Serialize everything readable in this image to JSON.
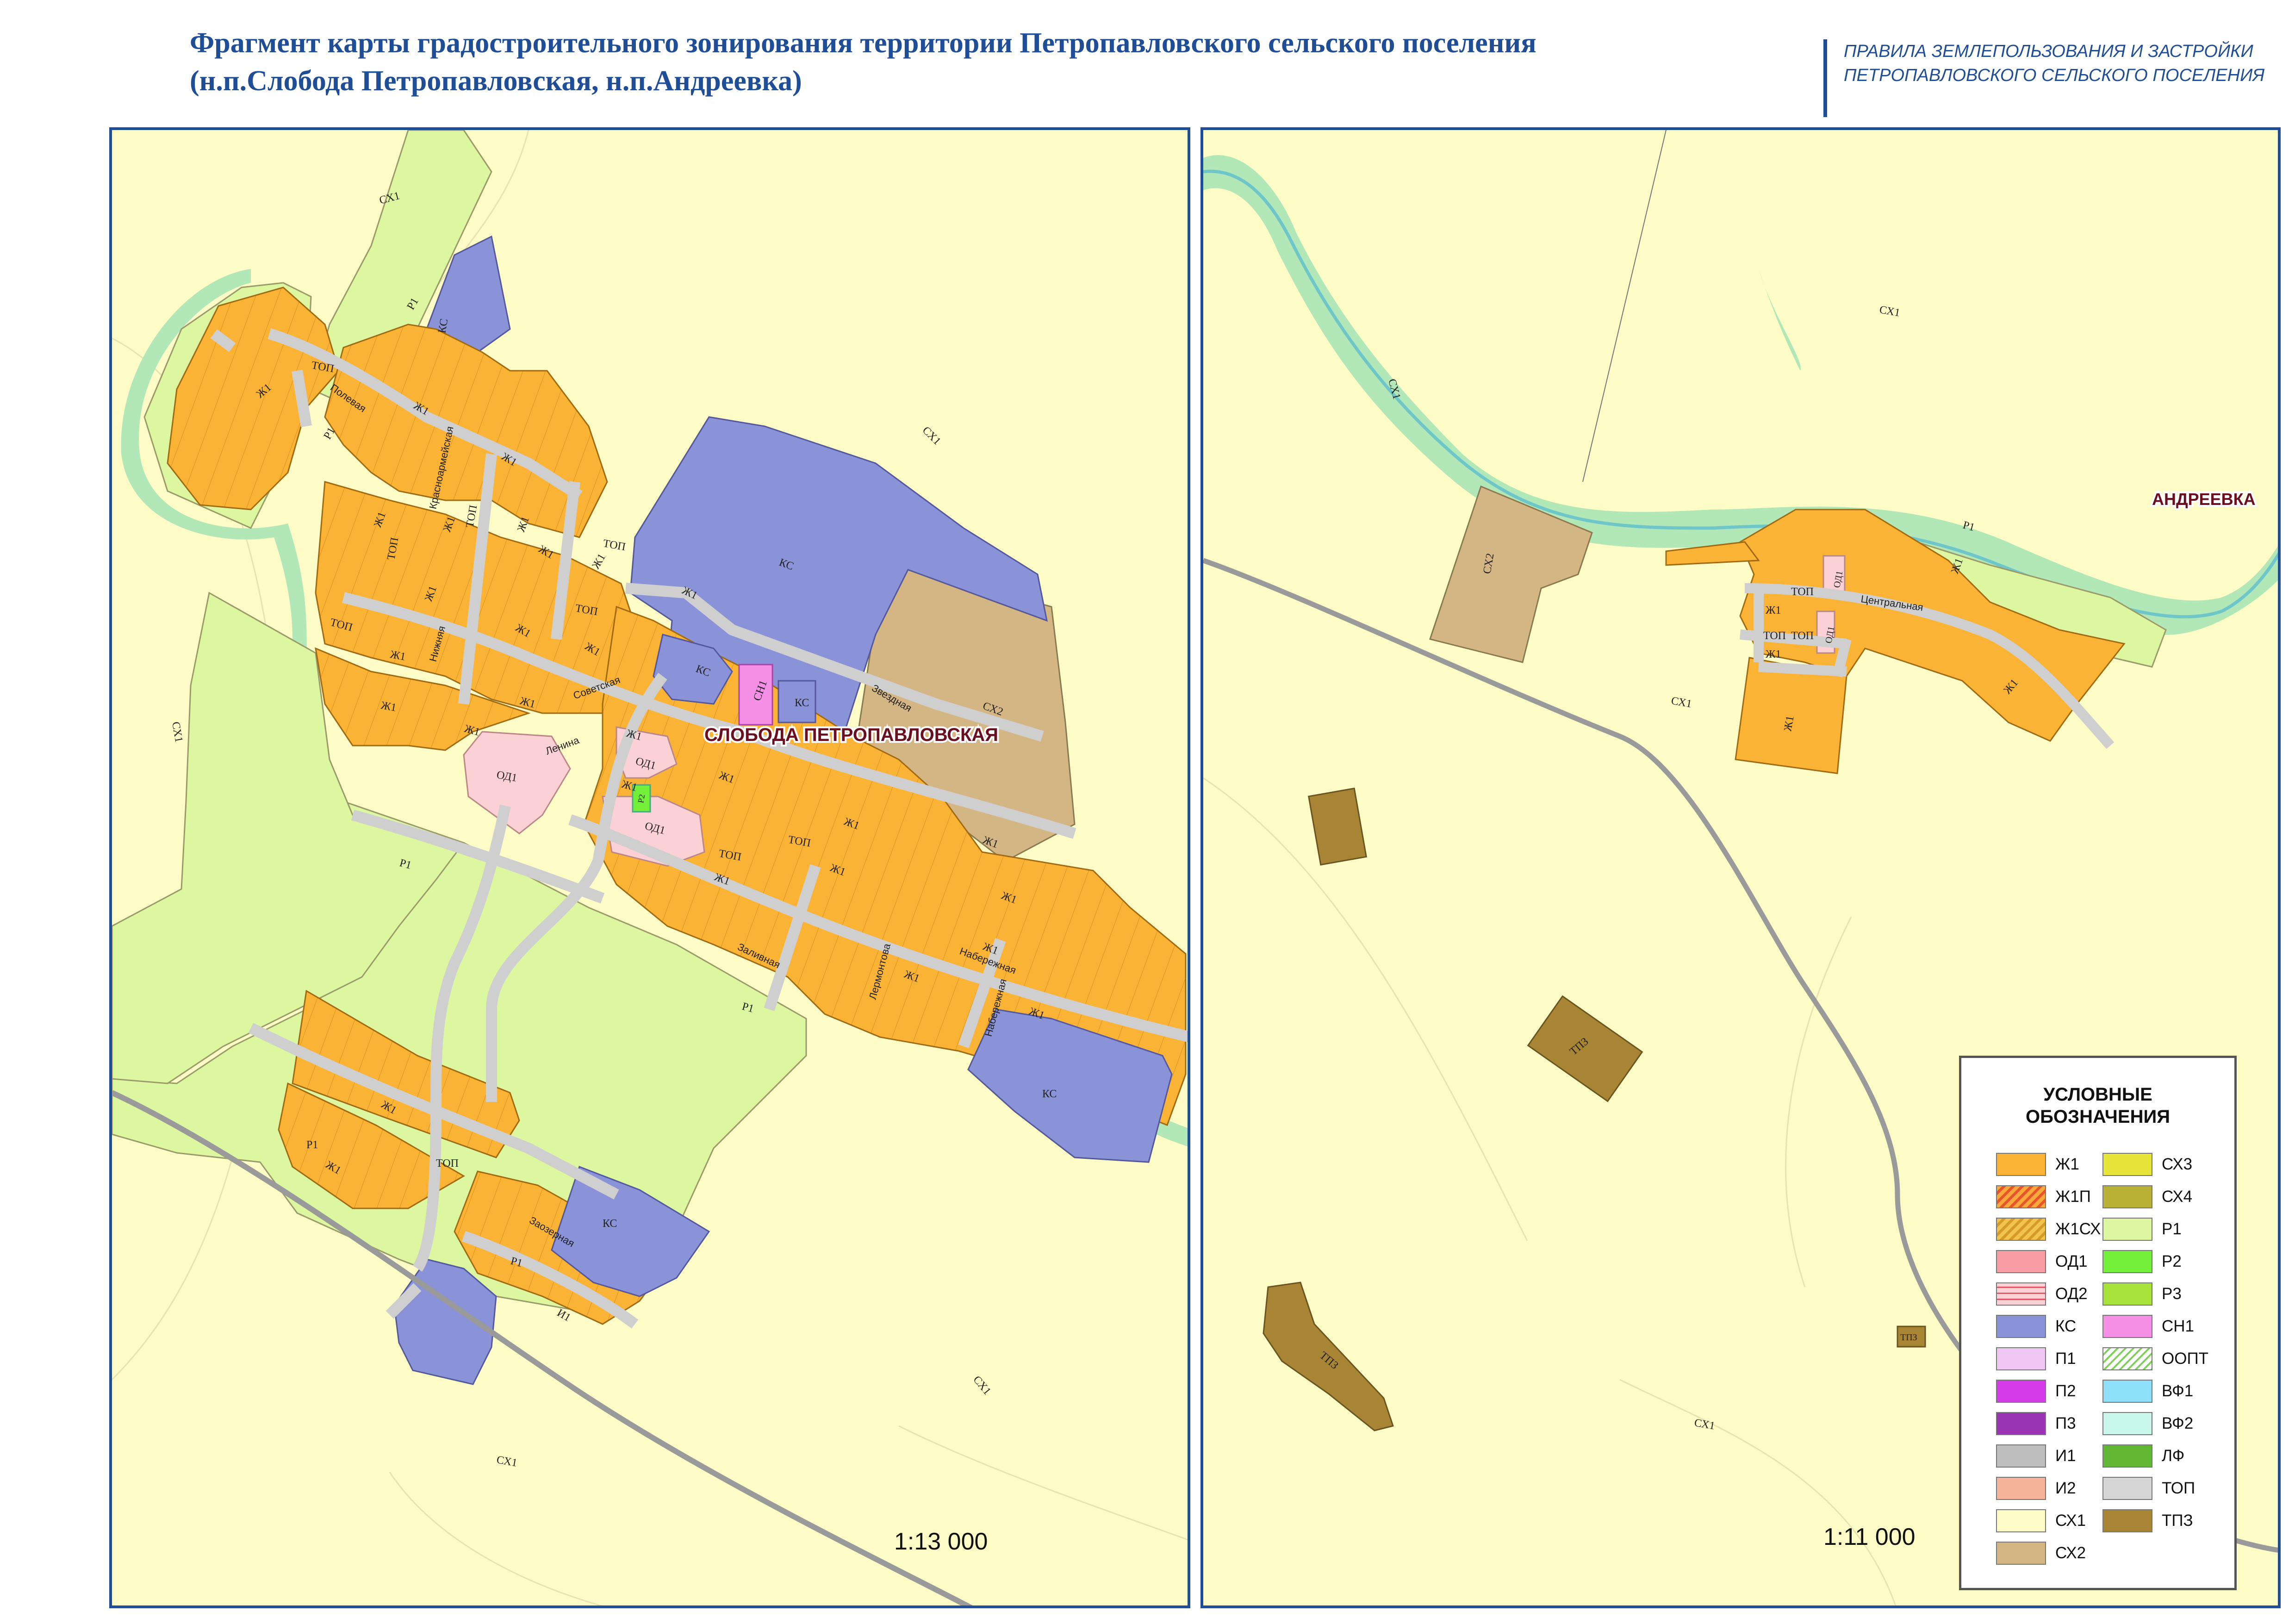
{
  "title": {
    "line1": "Фрагмент карты градостроительного зонирования территории Петропавловского сельского поселения",
    "line2": "(н.п.Слобода Петропавловская, н.п.Андреевка)"
  },
  "rules": {
    "line1": "ПРАВИЛА ЗЕМЛЕПОЛЬЗОВАНИЯ И ЗАСТРОЙКИ",
    "line2": "ПЕТРОПАВЛОВСКОГО СЕЛЬСКОГО ПОСЕЛЕНИЯ"
  },
  "colors": {
    "frame": "#1f4e96",
    "background_sx1": "#fefcc6",
    "zh1": "#fbb336",
    "ks": "#8a92d8",
    "r1": "#dcf7a0",
    "sx2": "#d4b684",
    "od1": "#fbd1d5",
    "top_roads": "#cfcfcf",
    "river": "#b2e8b8",
    "tp3": "#a88534",
    "settlement_label": "#6a0f1f"
  },
  "left_map": {
    "scale": "1:13 000",
    "settlement": "СЛОБОДА ПЕТРОПАВЛОВСКАЯ",
    "zone_labels": {
      "sx1_a": "СХ1",
      "sx1_b": "СХ1",
      "sx1_c": "СХ1",
      "sx1_d": "СХ1",
      "sx1_e": "СХ1",
      "r1_a": "Р1",
      "r1_b": "Р1",
      "r1_c": "Р1",
      "r1_d": "Р1",
      "r1_e": "Р1",
      "r1_f": "Р1",
      "zh1_a": "Ж1",
      "zh1_b": "Ж1",
      "zh1_c": "Ж1",
      "zh1_d": "Ж1",
      "zh1_e": "Ж1",
      "zh1_f": "Ж1",
      "zh1_g": "Ж1",
      "zh1_h": "Ж1",
      "zh1_i": "Ж1",
      "zh1_j": "Ж1",
      "zh1_k": "Ж1",
      "zh1_l": "Ж1",
      "zh1_m": "Ж1",
      "zh1_n": "Ж1",
      "zh1_o": "Ж1",
      "zh1_p": "Ж1",
      "zh1_q": "Ж1",
      "zh1_r": "Ж1",
      "zh1_s": "Ж1",
      "zh1_t": "Ж1",
      "zh1_u": "Ж1",
      "zh1_v": "Ж1",
      "zh1_w": "Ж1",
      "zh1_x": "Ж1",
      "zh1_y": "Ж1",
      "zh1_z": "Ж1",
      "zh1_aa": "Ж1",
      "zh1_ab": "Ж1",
      "zh1_ac": "Ж1",
      "ks_a": "КС",
      "ks_b": "КС",
      "ks_c": "КС",
      "ks_d": "КС",
      "ks_e": "КС",
      "ks_f": "КС",
      "sx2": "СХ2",
      "sn1": "СН1",
      "r2": "Р2",
      "od1_a": "ОД1",
      "od1_b": "ОД1",
      "od1_c": "ОД1",
      "top_a": "ТОП",
      "top_b": "ТОП",
      "top_c": "ТОП",
      "top_d": "ТОП",
      "top_e": "ТОП",
      "top_f": "ТОП",
      "top_g": "ТОП",
      "top_h": "ТОП",
      "top_i": "ТОП",
      "i1": "И1"
    },
    "streets": {
      "polevaya": "Полевая",
      "krasnoarmeyskaya": "Красноармейская",
      "nizhnyaya": "Нижняя",
      "sovetskaya": "Советская",
      "lenina": "Ленина",
      "zvezdnaya": "Звездная",
      "zalivnaya": "Заливная",
      "lermontova": "Лермонтова",
      "naberezhnaya_a": "Набережная",
      "naberezhnaya_b": "Набережная",
      "zaozernaya": "Заозерная"
    }
  },
  "right_map": {
    "scale": "1:11 000",
    "settlement": "АНДРЕЕВКА",
    "zone_labels": {
      "sx1_a": "СХ1",
      "sx1_b": "СХ1",
      "sx1_c": "СХ1",
      "sx1_d": "СХ1",
      "sx2": "СХ2",
      "r1": "Р1",
      "zh1_a": "Ж1",
      "zh1_b": "Ж1",
      "zh1_c": "Ж1",
      "zh1_d": "Ж1",
      "zh1_e": "Ж1",
      "od1_a": "ОД1",
      "od1_b": "ОД1",
      "top_a": "ТОП",
      "top_b": "ТОП",
      "top_c": "ТОП",
      "tp3_a": "ТПЗ",
      "tp3_b": "ТПЗ",
      "tp3_c": "ТПЗ",
      "street_central": "Центральная"
    }
  },
  "legend": {
    "title_line1": "УСЛОВНЫЕ",
    "title_line2": "ОБОЗНАЧЕНИЯ",
    "items": [
      {
        "label": "Ж1",
        "color": "#fbb336",
        "pattern": "solid"
      },
      {
        "label": "Ж1П",
        "color": "#f7a93a",
        "pattern": "hatch-red"
      },
      {
        "label": "Ж1СХ",
        "color": "#f3c44c",
        "pattern": "hatch-yellow"
      },
      {
        "label": "ОД1",
        "color": "#f99da4",
        "pattern": "solid"
      },
      {
        "label": "ОД2",
        "color": "#fbd1d5",
        "pattern": "lines-red"
      },
      {
        "label": "КС",
        "color": "#8a92d8",
        "pattern": "solid"
      },
      {
        "label": "П1",
        "color": "#efc7f2",
        "pattern": "solid"
      },
      {
        "label": "П2",
        "color": "#d63bea",
        "pattern": "solid"
      },
      {
        "label": "П3",
        "color": "#9a33b3",
        "pattern": "solid"
      },
      {
        "label": "И1",
        "color": "#bdbdbd",
        "pattern": "solid"
      },
      {
        "label": "И2",
        "color": "#f5b49a",
        "pattern": "solid"
      },
      {
        "label": "СХ1",
        "color": "#fefcc6",
        "pattern": "solid"
      },
      {
        "label": "СХ2",
        "color": "#d4b684",
        "pattern": "solid"
      },
      {
        "label": "СХ3",
        "color": "#e7e53a",
        "pattern": "solid"
      },
      {
        "label": "СХ4",
        "color": "#b9b136",
        "pattern": "solid"
      },
      {
        "label": "Р1",
        "color": "#dcf7a0",
        "pattern": "solid"
      },
      {
        "label": "Р2",
        "color": "#74f03a",
        "pattern": "solid"
      },
      {
        "label": "Р3",
        "color": "#a6e23a",
        "pattern": "solid"
      },
      {
        "label": "СН1",
        "color": "#f68fe6",
        "pattern": "solid"
      },
      {
        "label": "ООПТ",
        "color": "#ffffff",
        "pattern": "hatch-green"
      },
      {
        "label": "ВФ1",
        "color": "#8fe0fb",
        "pattern": "solid"
      },
      {
        "label": "ВФ2",
        "color": "#c9f7ea",
        "pattern": "solid"
      },
      {
        "label": "ЛФ",
        "color": "#63b833",
        "pattern": "solid"
      },
      {
        "label": "ТОП",
        "color": "#d6d6d6",
        "pattern": "solid"
      },
      {
        "label": "ТПЗ",
        "color": "#a88534",
        "pattern": "solid"
      }
    ]
  }
}
